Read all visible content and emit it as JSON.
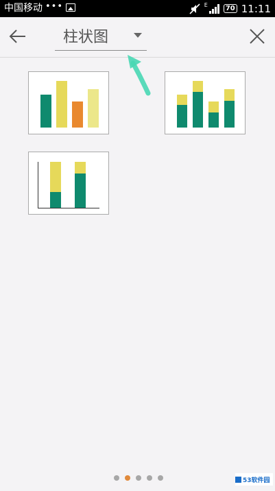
{
  "status": {
    "carrier": "中国移动",
    "dots": "•••",
    "net_type": "E",
    "battery": "70",
    "time": "11:11"
  },
  "toolbar": {
    "title": "柱状图"
  },
  "thumbnails": [
    {
      "name": "clustered-column"
    },
    {
      "name": "stacked-column"
    },
    {
      "name": "percent-stacked-column"
    }
  ],
  "pager": {
    "count": 5,
    "active_index": 1
  },
  "colors": {
    "green": "#0f8a6e",
    "yellow": "#e6d95a",
    "light_yellow": "#ece78a",
    "orange": "#e9892f",
    "annotation_arrow": "#48d7b4"
  },
  "watermark": {
    "text": "53软件园"
  }
}
